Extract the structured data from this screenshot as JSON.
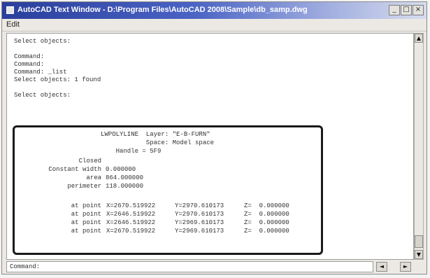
{
  "window": {
    "title": "AutoCAD Text Window - D:\\Program Files\\AutoCAD 2008\\Sample\\db_samp.dwg",
    "minimize_glyph": "_",
    "maximize_glyph": "□",
    "close_glyph": "×"
  },
  "menu": {
    "edit": "Edit"
  },
  "log_lines": [
    "Select objects:",
    "",
    "Command:",
    "Command:",
    "Command: _list",
    "Select objects: 1 found",
    "",
    "Select objects:"
  ],
  "list_output": {
    "header": [
      "LWPOLYLINE  Layer: \"E-B-FURN\"",
      "            Space: Model space",
      "    Handle = 5F9"
    ],
    "props": [
      {
        "label": "Closed",
        "value": ""
      },
      {
        "label": "Constant width",
        "value": "0.000000"
      },
      {
        "label": "area",
        "value": "864.000000"
      },
      {
        "label": "perimeter",
        "value": "118.000000"
      }
    ],
    "points": [
      {
        "label": "at point",
        "x": "X=2670.519922",
        "y": "Y=2970.610173",
        "z": "Z=  0.000000"
      },
      {
        "label": "at point",
        "x": "X=2646.519922",
        "y": "Y=2970.610173",
        "z": "Z=  0.000000"
      },
      {
        "label": "at point",
        "x": "X=2646.519922",
        "y": "Y=2969.610173",
        "z": "Z=  0.000000"
      },
      {
        "label": "at point",
        "x": "X=2670.519922",
        "y": "Y=2969.610173",
        "z": "Z=  0.000000"
      }
    ]
  },
  "command_line": {
    "prompt": "Command:",
    "value": ""
  },
  "scroll": {
    "up": "▲",
    "down": "▼",
    "left": "◄",
    "right": "►"
  }
}
